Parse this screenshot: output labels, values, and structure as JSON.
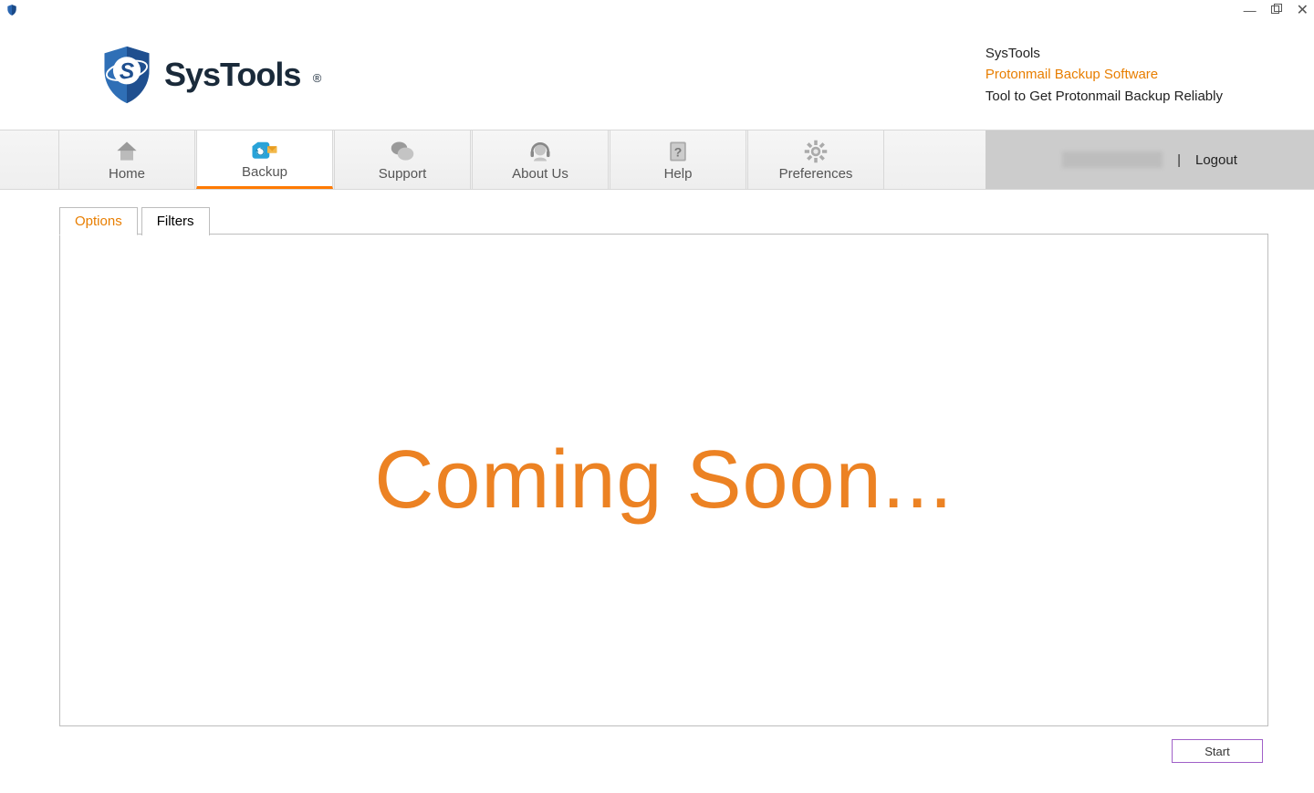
{
  "header": {
    "brand_name": "SysTools",
    "line1": "SysTools",
    "line2": "Protonmail Backup Software",
    "line3": "Tool to Get Protonmail Backup Reliably"
  },
  "nav": {
    "items": [
      {
        "label": "Home",
        "icon": "home"
      },
      {
        "label": "Backup",
        "icon": "backup",
        "active": true
      },
      {
        "label": "Support",
        "icon": "support"
      },
      {
        "label": "About Us",
        "icon": "about"
      },
      {
        "label": "Help",
        "icon": "help"
      },
      {
        "label": "Preferences",
        "icon": "prefs"
      }
    ],
    "logout_label": "Logout"
  },
  "tabs": {
    "items": [
      {
        "label": "Options",
        "active": true
      },
      {
        "label": "Filters"
      }
    ]
  },
  "panel": {
    "message": "Coming Soon..."
  },
  "footer": {
    "start_label": "Start"
  }
}
